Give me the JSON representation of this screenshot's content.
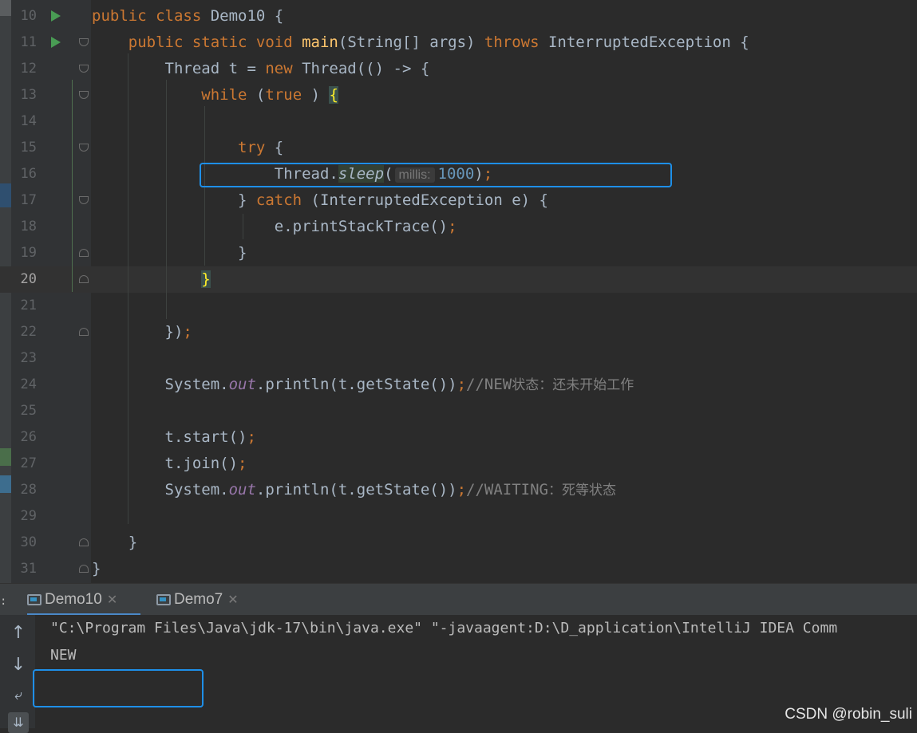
{
  "editor": {
    "lines": [
      {
        "num": "10",
        "parts": [
          [
            "kw",
            "public class "
          ],
          [
            "",
            "Demo10 {"
          ]
        ]
      },
      {
        "num": "11",
        "parts": [
          [
            "",
            "    "
          ],
          [
            "kw",
            "public static void "
          ],
          [
            "fn",
            "main"
          ],
          [
            "",
            "(String[] args) "
          ],
          [
            "kw",
            "throws "
          ],
          [
            "",
            "InterruptedException {"
          ]
        ]
      },
      {
        "num": "12",
        "parts": [
          [
            "",
            "        Thread t = "
          ],
          [
            "kw",
            "new "
          ],
          [
            "",
            "Thread(() -> {"
          ]
        ]
      },
      {
        "num": "13",
        "parts": [
          [
            "",
            "            "
          ],
          [
            "kw",
            "while "
          ],
          [
            "",
            "("
          ],
          [
            "kw",
            "true"
          ],
          [
            "",
            " ) "
          ],
          [
            "bracehl",
            "{"
          ]
        ]
      },
      {
        "num": "14",
        "parts": []
      },
      {
        "num": "15",
        "parts": [
          [
            "",
            "                "
          ],
          [
            "kw",
            "try "
          ],
          [
            "",
            "{"
          ]
        ]
      },
      {
        "num": "16",
        "parts": [
          [
            "",
            "                    Thread."
          ],
          [
            "sleephl it",
            "sleep"
          ],
          [
            "",
            "("
          ],
          [
            "hint",
            "millis:"
          ],
          [
            "num",
            "1000"
          ],
          [
            "",
            ")"
          ],
          [
            "kw",
            ";"
          ]
        ]
      },
      {
        "num": "17",
        "parts": [
          [
            "",
            "                } "
          ],
          [
            "kw",
            "catch "
          ],
          [
            "",
            "(InterruptedException e) {"
          ]
        ]
      },
      {
        "num": "18",
        "parts": [
          [
            "",
            "                    e.printStackTrace()"
          ],
          [
            "kw",
            ";"
          ]
        ]
      },
      {
        "num": "19",
        "parts": [
          [
            "",
            "                }"
          ]
        ]
      },
      {
        "num": "20",
        "parts": [
          [
            "",
            "            "
          ],
          [
            "bracehl",
            "}"
          ]
        ]
      },
      {
        "num": "21",
        "parts": []
      },
      {
        "num": "22",
        "parts": [
          [
            "",
            "        })"
          ],
          [
            "kw",
            ";"
          ]
        ]
      },
      {
        "num": "23",
        "parts": []
      },
      {
        "num": "24",
        "parts": [
          [
            "",
            "        System."
          ],
          [
            "st",
            "out"
          ],
          [
            "",
            ".println(t.getState())"
          ],
          [
            "kw",
            ";"
          ],
          [
            "cm",
            "//NEW"
          ],
          [
            "cmz",
            "状态：还未开始工作"
          ]
        ]
      },
      {
        "num": "25",
        "parts": []
      },
      {
        "num": "26",
        "parts": [
          [
            "",
            "        t.start()"
          ],
          [
            "kw",
            ";"
          ]
        ]
      },
      {
        "num": "27",
        "parts": [
          [
            "",
            "        t.join()"
          ],
          [
            "kw",
            ";"
          ]
        ]
      },
      {
        "num": "28",
        "parts": [
          [
            "",
            "        System."
          ],
          [
            "st",
            "out"
          ],
          [
            "",
            ".println(t.getState())"
          ],
          [
            "kw",
            ";"
          ],
          [
            "cm",
            "//WAITING"
          ],
          [
            "cmz",
            "：死等状态"
          ]
        ]
      },
      {
        "num": "29",
        "parts": []
      },
      {
        "num": "30",
        "parts": [
          [
            "",
            "    }"
          ]
        ]
      },
      {
        "num": "31",
        "parts": [
          [
            "",
            "}"
          ]
        ]
      }
    ]
  },
  "run_tabs": [
    {
      "label": "Demo10",
      "active": true
    },
    {
      "label": "Demo7",
      "active": false
    }
  ],
  "console": {
    "command_line": "\"C:\\Program Files\\Java\\jdk-17\\bin\\java.exe\" \"-javaagent:D:\\D_application\\IntelliJ IDEA Comm",
    "output_line": "NEW"
  },
  "watermark": "CSDN @robin_suli",
  "colors": {
    "accent": "#1e8fe8",
    "keyword": "#cc7832",
    "run_icon": "#499c54"
  }
}
